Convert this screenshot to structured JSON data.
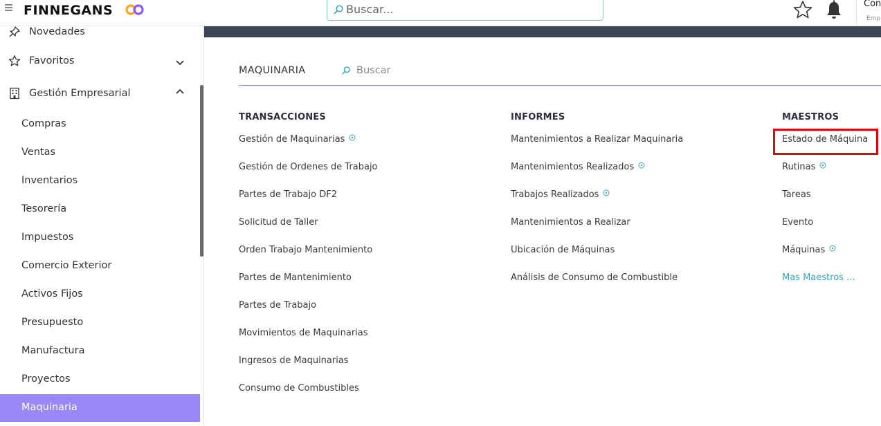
{
  "header": {
    "logo_text": "FINNEGANS",
    "search_placeholder": "Buscar...",
    "user_name": "Con",
    "user_sub": "Emp"
  },
  "sidebar": {
    "top_items": [
      {
        "label": "Novedades",
        "icon": "pin-icon"
      },
      {
        "label": "Favoritos",
        "icon": "star-icon",
        "chevron": "down"
      },
      {
        "label": "Gestión Empresarial",
        "icon": "building-icon",
        "chevron": "up"
      }
    ],
    "sub_items": [
      {
        "label": "Compras"
      },
      {
        "label": "Ventas"
      },
      {
        "label": "Inventarios"
      },
      {
        "label": "Tesorería"
      },
      {
        "label": "Impuestos"
      },
      {
        "label": "Comercio Exterior"
      },
      {
        "label": "Activos Fijos"
      },
      {
        "label": "Presupuesto"
      },
      {
        "label": "Manufactura"
      },
      {
        "label": "Proyectos"
      },
      {
        "label": "Maquinaria",
        "active": true
      }
    ]
  },
  "main": {
    "module_title": "MAQUINARIA",
    "search_placeholder": "Buscar",
    "columns": [
      {
        "heading": "TRANSACCIONES",
        "links": [
          {
            "label": "Gestión de Maquinarias",
            "help": true
          },
          {
            "label": "Gestión de Ordenes de Trabajo"
          },
          {
            "label": "Partes de Trabajo DF2"
          },
          {
            "label": "Solicitud de Taller"
          },
          {
            "label": "Orden Trabajo Mantenimiento"
          },
          {
            "label": "Partes de Mantenimiento"
          },
          {
            "label": "Partes de Trabajo"
          },
          {
            "label": "Movimientos de Maquinarias"
          },
          {
            "label": "Ingresos de Maquinarias"
          },
          {
            "label": "Consumo de Combustibles"
          }
        ]
      },
      {
        "heading": "INFORMES",
        "links": [
          {
            "label": "Mantenimientos a Realizar Maquinaria"
          },
          {
            "label": "Mantenimientos Realizados",
            "help": true
          },
          {
            "label": "Trabajos Realizados",
            "help": true
          },
          {
            "label": "Mantenimientos a Realizar"
          },
          {
            "label": "Ubicación de Máquinas"
          },
          {
            "label": "Análisis de Consumo de Combustible"
          }
        ]
      },
      {
        "heading": "MAESTROS",
        "links": [
          {
            "label": "Estado de Máquina",
            "highlighted": true
          },
          {
            "label": "Rutinas",
            "help": true
          },
          {
            "label": "Tareas"
          },
          {
            "label": "Evento"
          },
          {
            "label": "Máquinas",
            "help": true
          },
          {
            "label": "Mas Maestros ...",
            "more": true
          }
        ]
      }
    ]
  },
  "colors": {
    "active_bg": "#9b87f5",
    "accent": "#3aa3b8",
    "highlight_border": "#e00000",
    "dark_strip": "#3b4558"
  }
}
